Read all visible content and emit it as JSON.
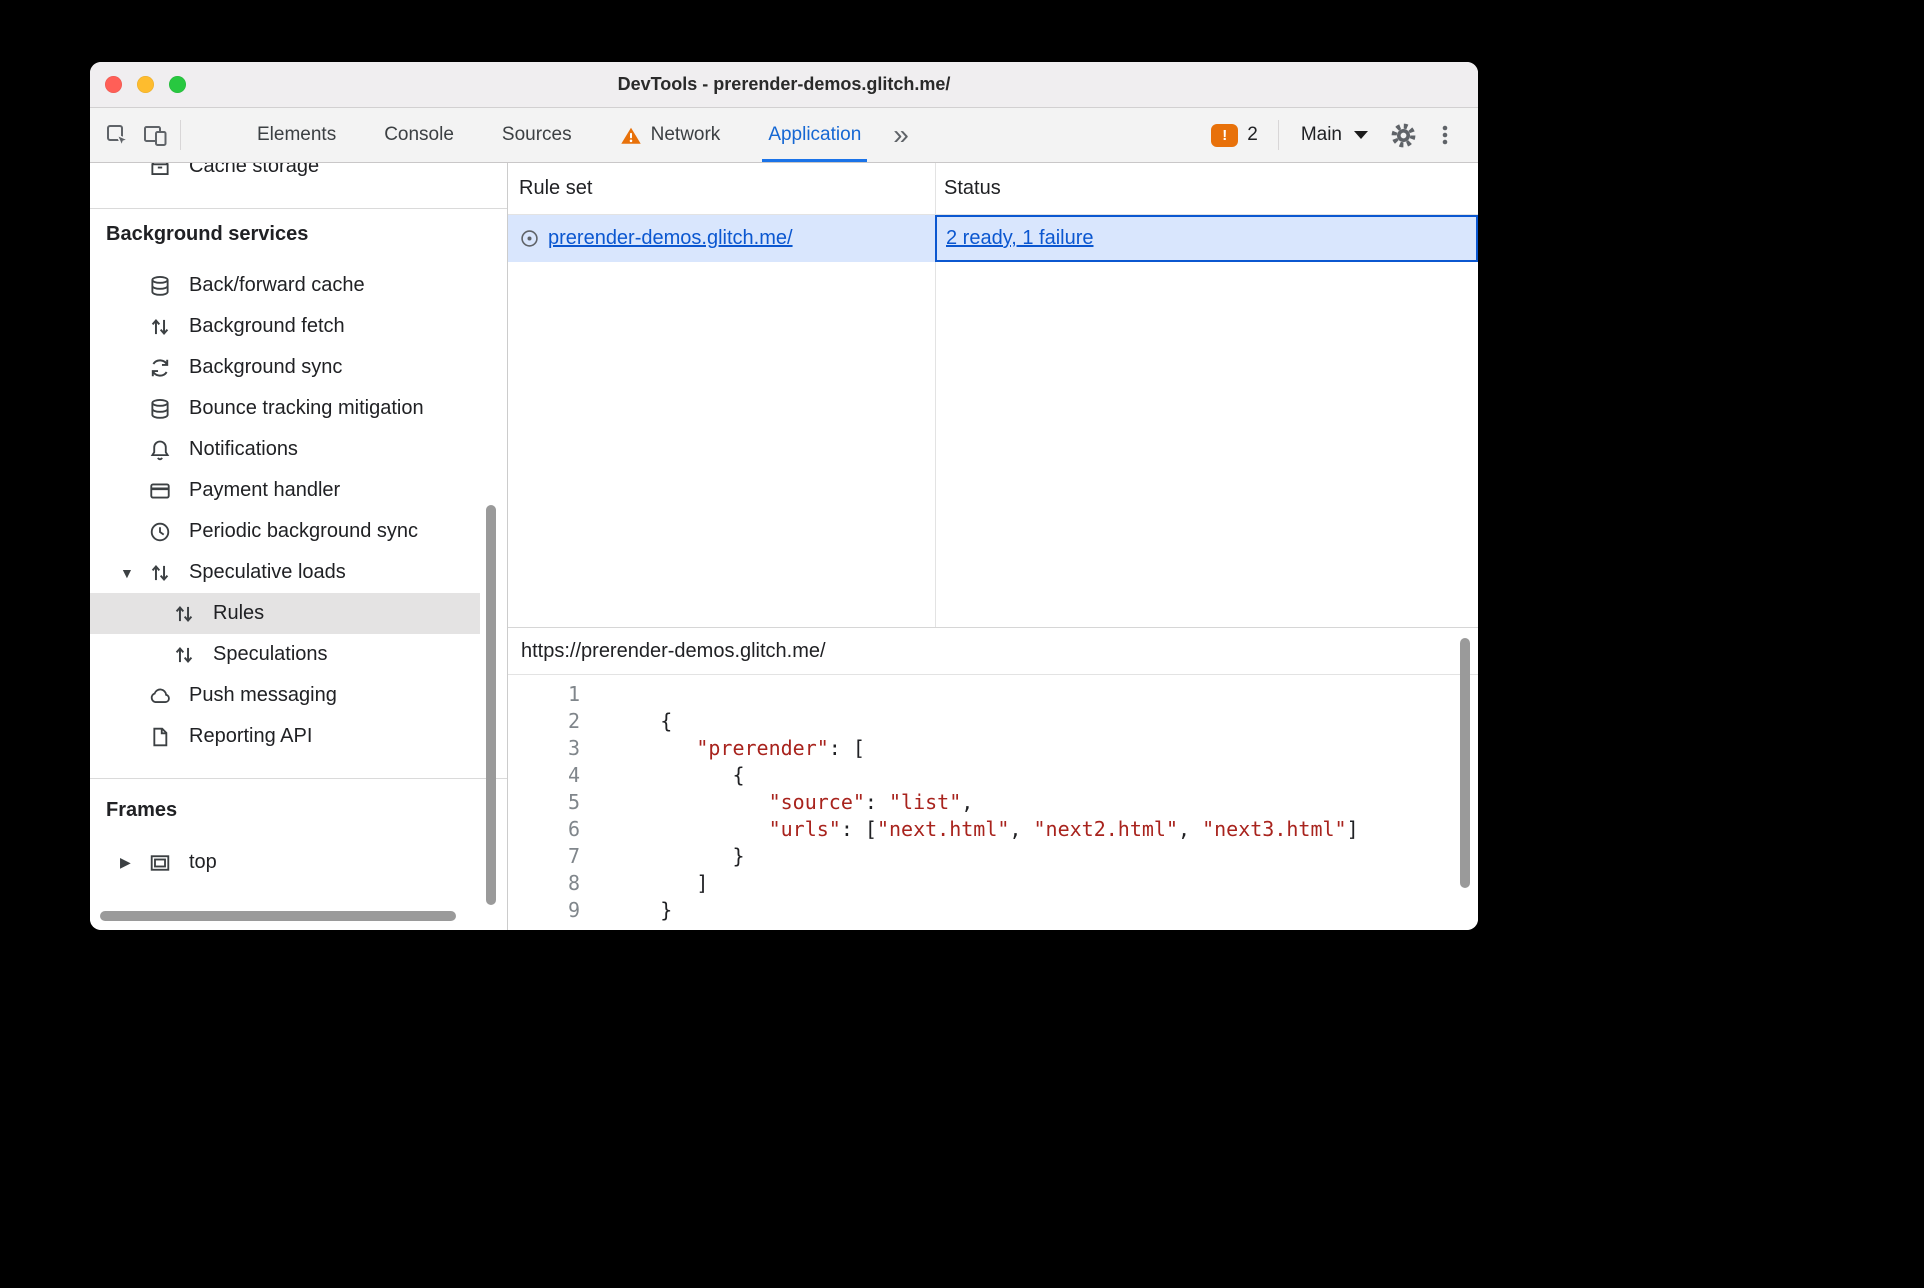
{
  "window": {
    "title": "DevTools - prerender-demos.glitch.me/"
  },
  "toolbar": {
    "tabs": [
      {
        "label": "Elements"
      },
      {
        "label": "Console"
      },
      {
        "label": "Sources"
      },
      {
        "label": "Network",
        "warning": true
      },
      {
        "label": "Application",
        "active": true
      }
    ],
    "more_tabs_label": "»",
    "issues": {
      "glyph": "!",
      "count": "2"
    },
    "target_label": "Main"
  },
  "sidebar": {
    "glyphs": {
      "expanded": "▼",
      "collapsed": "▶"
    },
    "top_item": {
      "label": "Cache storage",
      "icon": "box"
    },
    "background_services": {
      "title": "Background services",
      "items": [
        {
          "label": "Back/forward cache",
          "icon": "database"
        },
        {
          "label": "Background fetch",
          "icon": "updown"
        },
        {
          "label": "Background sync",
          "icon": "sync"
        },
        {
          "label": "Bounce tracking mitigation",
          "icon": "database"
        },
        {
          "label": "Notifications",
          "icon": "bell"
        },
        {
          "label": "Payment handler",
          "icon": "card"
        },
        {
          "label": "Periodic background sync",
          "icon": "clock"
        },
        {
          "label": "Speculative loads",
          "icon": "updown",
          "expanded": true,
          "children": [
            {
              "label": "Rules",
              "icon": "updown",
              "selected": true
            },
            {
              "label": "Speculations",
              "icon": "updown"
            }
          ]
        },
        {
          "label": "Push messaging",
          "icon": "cloud"
        },
        {
          "label": "Reporting API",
          "icon": "doc"
        }
      ]
    },
    "frames": {
      "title": "Frames",
      "items": [
        {
          "label": "top",
          "icon": "frame",
          "expanded": false
        }
      ]
    }
  },
  "main": {
    "grid": {
      "columns": [
        "Rule set",
        "Status"
      ],
      "rows": [
        {
          "rule_set": "prerender-demos.glitch.me/",
          "status": "2 ready, 1 failure",
          "selected": true,
          "icon": "ruleset"
        }
      ]
    },
    "preview": {
      "url": "https://prerender-demos.glitch.me/",
      "lines": [
        {
          "num": "1",
          "parts": []
        },
        {
          "num": "2",
          "parts": [
            [
              "p",
              "     {"
            ]
          ]
        },
        {
          "num": "3",
          "parts": [
            [
              "p",
              "        "
            ],
            [
              "s",
              "\"prerender\""
            ],
            [
              "p",
              ": ["
            ]
          ]
        },
        {
          "num": "4",
          "parts": [
            [
              "p",
              "           {"
            ]
          ]
        },
        {
          "num": "5",
          "parts": [
            [
              "p",
              "              "
            ],
            [
              "s",
              "\"source\""
            ],
            [
              "p",
              ": "
            ],
            [
              "s",
              "\"list\""
            ],
            [
              "p",
              ","
            ]
          ]
        },
        {
          "num": "6",
          "parts": [
            [
              "p",
              "              "
            ],
            [
              "s",
              "\"urls\""
            ],
            [
              "p",
              ": ["
            ],
            [
              "s",
              "\"next.html\""
            ],
            [
              "p",
              ", "
            ],
            [
              "s",
              "\"next2.html\""
            ],
            [
              "p",
              ", "
            ],
            [
              "s",
              "\"next3.html\""
            ],
            [
              "p",
              "]"
            ]
          ]
        },
        {
          "num": "7",
          "parts": [
            [
              "p",
              "           }"
            ]
          ]
        },
        {
          "num": "8",
          "parts": [
            [
              "p",
              "        ]"
            ]
          ]
        },
        {
          "num": "9",
          "parts": [
            [
              "p",
              "     }"
            ]
          ]
        }
      ]
    }
  },
  "colors": {
    "accent_blue": "#1a73e8",
    "active_tab_text": "#1567d3",
    "link": "#0b57d0",
    "selection_bg": "#d9e6fd",
    "focus_border": "#0b57d0",
    "warning_orange": "#e8710a",
    "token_string": "#a8231d",
    "sidebar_selected_bg": "#e4e3e3"
  }
}
